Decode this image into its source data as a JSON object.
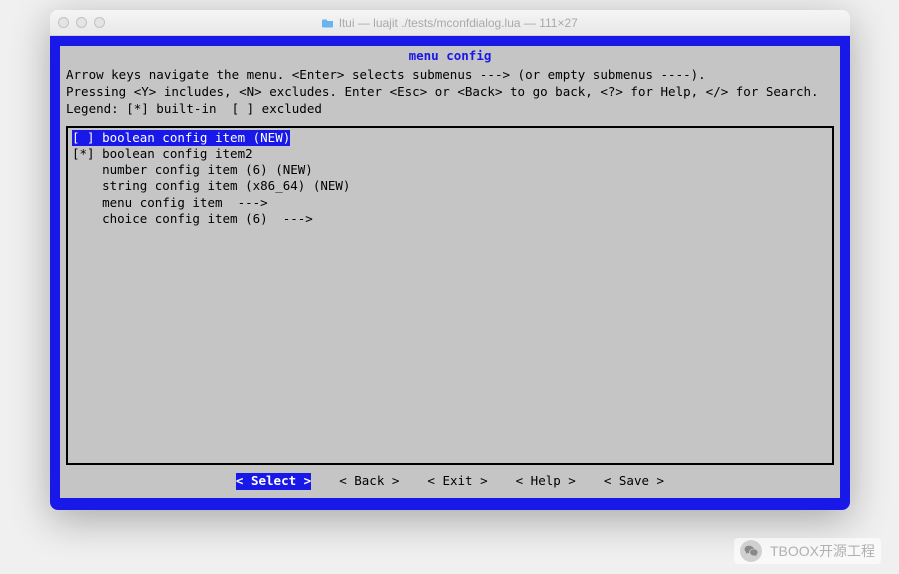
{
  "window": {
    "title": "ltui — luajit ./tests/mconfdialog.lua — 111×27"
  },
  "dialog": {
    "title": "menu config",
    "instructions": "Arrow keys navigate the menu. <Enter> selects submenus ---> (or empty submenus ----).\nPressing <Y> includes, <N> excludes. Enter <Esc> or <Back> to go back, <?> for Help, </> for Search. Legend: [*] built-in  [ ] excluded"
  },
  "menu_items": [
    {
      "text": "[ ] boolean config item (NEW)",
      "selected": true
    },
    {
      "text": "[*] boolean config item2",
      "selected": false
    },
    {
      "text": "    number config item (6) (NEW)",
      "selected": false
    },
    {
      "text": "    string config item (x86_64) (NEW)",
      "selected": false
    },
    {
      "text": "    menu config item  --->",
      "selected": false
    },
    {
      "text": "    choice config item (6)  --->",
      "selected": false
    }
  ],
  "buttons": [
    {
      "label": "< Select >",
      "selected": true
    },
    {
      "label": "< Back >",
      "selected": false
    },
    {
      "label": "< Exit >",
      "selected": false
    },
    {
      "label": "< Help >",
      "selected": false
    },
    {
      "label": "< Save >",
      "selected": false
    }
  ],
  "watermark": {
    "text": "TBOOX开源工程"
  }
}
